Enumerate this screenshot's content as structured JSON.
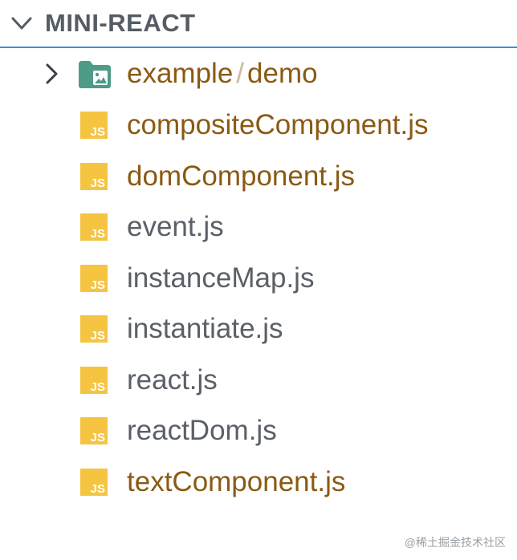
{
  "explorer": {
    "title": "MINI-REACT",
    "folder": {
      "parent": "example",
      "separator": "/",
      "child": "demo",
      "icon": "image-folder-icon"
    },
    "files": [
      {
        "name": "compositeComponent.js",
        "state": "modified",
        "icon": "js-file-icon"
      },
      {
        "name": "domComponent.js",
        "state": "modified",
        "icon": "js-file-icon"
      },
      {
        "name": "event.js",
        "state": "normal",
        "icon": "js-file-icon"
      },
      {
        "name": "instanceMap.js",
        "state": "normal",
        "icon": "js-file-icon"
      },
      {
        "name": "instantiate.js",
        "state": "normal",
        "icon": "js-file-icon"
      },
      {
        "name": "react.js",
        "state": "normal",
        "icon": "js-file-icon"
      },
      {
        "name": "reactDom.js",
        "state": "normal",
        "icon": "js-file-icon"
      },
      {
        "name": "textComponent.js",
        "state": "modified",
        "icon": "js-file-icon"
      }
    ]
  },
  "watermark": "@稀土掘金技术社区",
  "colors": {
    "accent": "#3d8fd8",
    "modified": "#8a5a13",
    "normal": "#5b6068",
    "js_icon": "#f5c542",
    "folder_icon": "#4e9b87"
  }
}
